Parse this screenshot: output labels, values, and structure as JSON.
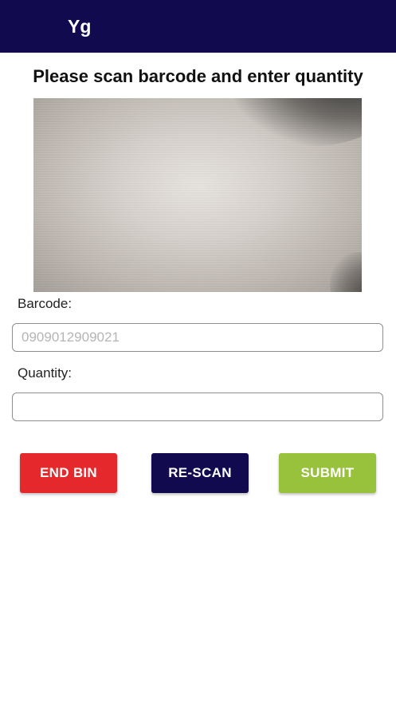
{
  "app_bar": {
    "title": "Yg"
  },
  "instruction": "Please scan barcode and enter quantity",
  "camera_preview": {
    "label": "camera-preview"
  },
  "fields": {
    "barcode_label": "Barcode:",
    "barcode_placeholder": "0909012909021",
    "barcode_value": "",
    "quantity_label": "Quantity:",
    "quantity_placeholder": "",
    "quantity_value": ""
  },
  "buttons": {
    "end_bin": "END BIN",
    "rescan": "RE-SCAN",
    "submit": "SUBMIT"
  },
  "colors": {
    "app_bar": "#120a4f",
    "end_bin": "#e5282c",
    "rescan": "#120a4f",
    "submit": "#99c23c"
  }
}
